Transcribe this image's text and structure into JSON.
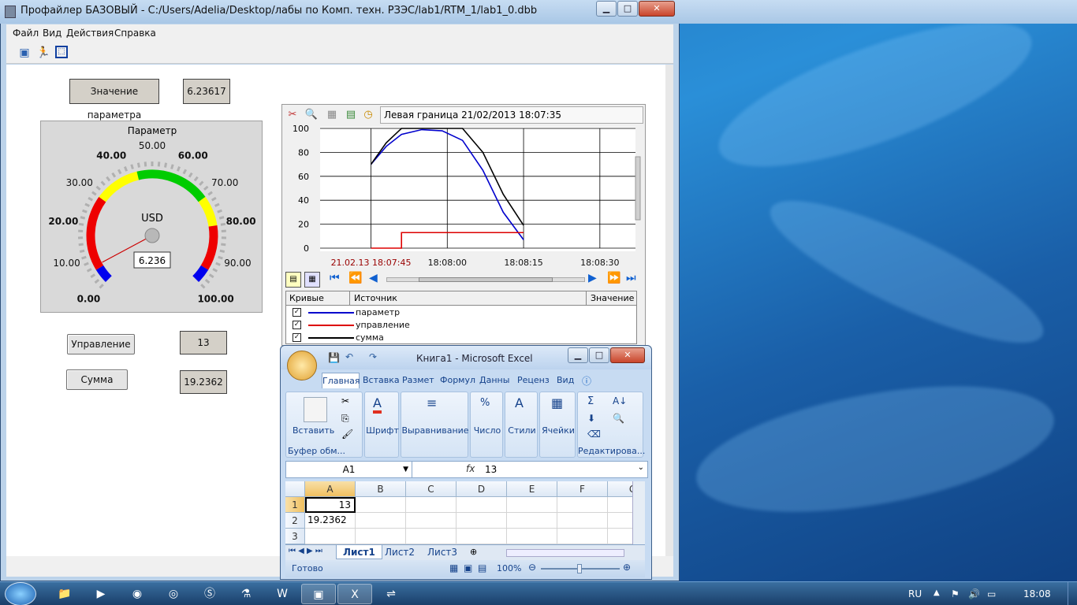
{
  "colors": {
    "desktop": "#1e6fb8",
    "series_param": "#0000cc",
    "series_control": "#dd0000",
    "series_sum": "#000000"
  },
  "profiler": {
    "title": "Профайлер БАЗОВЫЙ - C:/Users/Adelia/Desktop/лабы по Комп. техн. РЗЭС/lab1/RTM_1/lab1_0.dbb",
    "menu": [
      "Файл",
      "Вид",
      "Действия",
      "Справка"
    ],
    "toolbar_icons": [
      "open-book-icon",
      "run-icon",
      "fit-window-icon"
    ],
    "param_label": "Значение параметра",
    "param_value": "6.23617",
    "control_button": "Управление",
    "control_value": "13",
    "sum_button": "Сумма",
    "sum_value": "19.2362"
  },
  "gauge": {
    "title": "Параметр",
    "unit": "USD",
    "readout": "6.236",
    "min": 0,
    "max": 100,
    "value": 6.236,
    "ticks": [
      "0.00",
      "10.00",
      "20.00",
      "30.00",
      "40.00",
      "50.00",
      "60.00",
      "70.00",
      "80.00",
      "90.00",
      "100.00"
    ],
    "bands": [
      {
        "from": 0,
        "to": 5,
        "color": "#0000ee"
      },
      {
        "from": 5,
        "to": 30,
        "color": "#ee0000"
      },
      {
        "from": 30,
        "to": 45,
        "color": "#ffff00"
      },
      {
        "from": 45,
        "to": 70,
        "color": "#00cc00"
      },
      {
        "from": 70,
        "to": 80,
        "color": "#ffff00"
      },
      {
        "from": 80,
        "to": 95,
        "color": "#ee0000"
      },
      {
        "from": 95,
        "to": 100,
        "color": "#0000ee"
      }
    ]
  },
  "trend": {
    "left_border_label": "Левая граница 21/02/2013 18:07:35",
    "legend_headers": {
      "curves": "Кривые",
      "source": "Источник",
      "value": "Значение"
    },
    "legend": [
      {
        "name": "параметр",
        "color": "#0000cc"
      },
      {
        "name": "управление",
        "color": "#dd0000"
      },
      {
        "name": "сумма",
        "color": "#000000"
      }
    ]
  },
  "chart_data": {
    "type": "line",
    "ylim": [
      0,
      100
    ],
    "yticks": [
      "100",
      "80",
      "60",
      "40",
      "20",
      "0"
    ],
    "xticks": [
      "21.02.13 18:07:45",
      "18:08:00",
      "18:08:15",
      "18:08:30"
    ],
    "x_seconds_after_1807_35": [
      10,
      13,
      16,
      20,
      24,
      28,
      32,
      36,
      40
    ],
    "series": [
      {
        "name": "параметр",
        "values": [
          70,
          85,
          95,
          99,
          98,
          90,
          65,
          30,
          7
        ]
      },
      {
        "name": "управление",
        "values": [
          0,
          0,
          13,
          13,
          13,
          13,
          13,
          13,
          13
        ]
      },
      {
        "name": "сумма",
        "values": [
          70,
          88,
          100,
          100,
          100,
          100,
          80,
          45,
          19
        ]
      }
    ]
  },
  "excel": {
    "title": "Книга1 - Microsoft Excel",
    "tabs": [
      "Главная",
      "Вставка",
      "Размет",
      "Формул",
      "Данны",
      "Реценз",
      "Вид"
    ],
    "groups": [
      {
        "label": "Буфер обм...",
        "button": "Вставить"
      },
      {
        "label": "Шрифт"
      },
      {
        "label": "Выравнивание"
      },
      {
        "label": "Число"
      },
      {
        "label": "Стили"
      },
      {
        "label": "Ячейки"
      },
      {
        "label": "Редактирова..."
      }
    ],
    "name_box": "A1",
    "formula": "13",
    "fx": "fx",
    "columns": [
      "A",
      "B",
      "C",
      "D",
      "E",
      "F",
      "G"
    ],
    "rows": [
      "1",
      "2",
      "3"
    ],
    "cells": {
      "A1": "13",
      "A2": "19.2362"
    },
    "sheets": [
      "Лист1",
      "Лист2",
      "Лист3"
    ],
    "status": "Готово",
    "zoom": "100%"
  },
  "taskbar": {
    "lang": "RU",
    "clock": "18:08",
    "icons": [
      "explorer-icon",
      "media-player-icon",
      "chrome-icon",
      "firefox-icon",
      "skype-icon",
      "lab-flask-icon",
      "word-icon",
      "profiler-task-icon",
      "excel-task-icon",
      "usb-icon"
    ]
  }
}
